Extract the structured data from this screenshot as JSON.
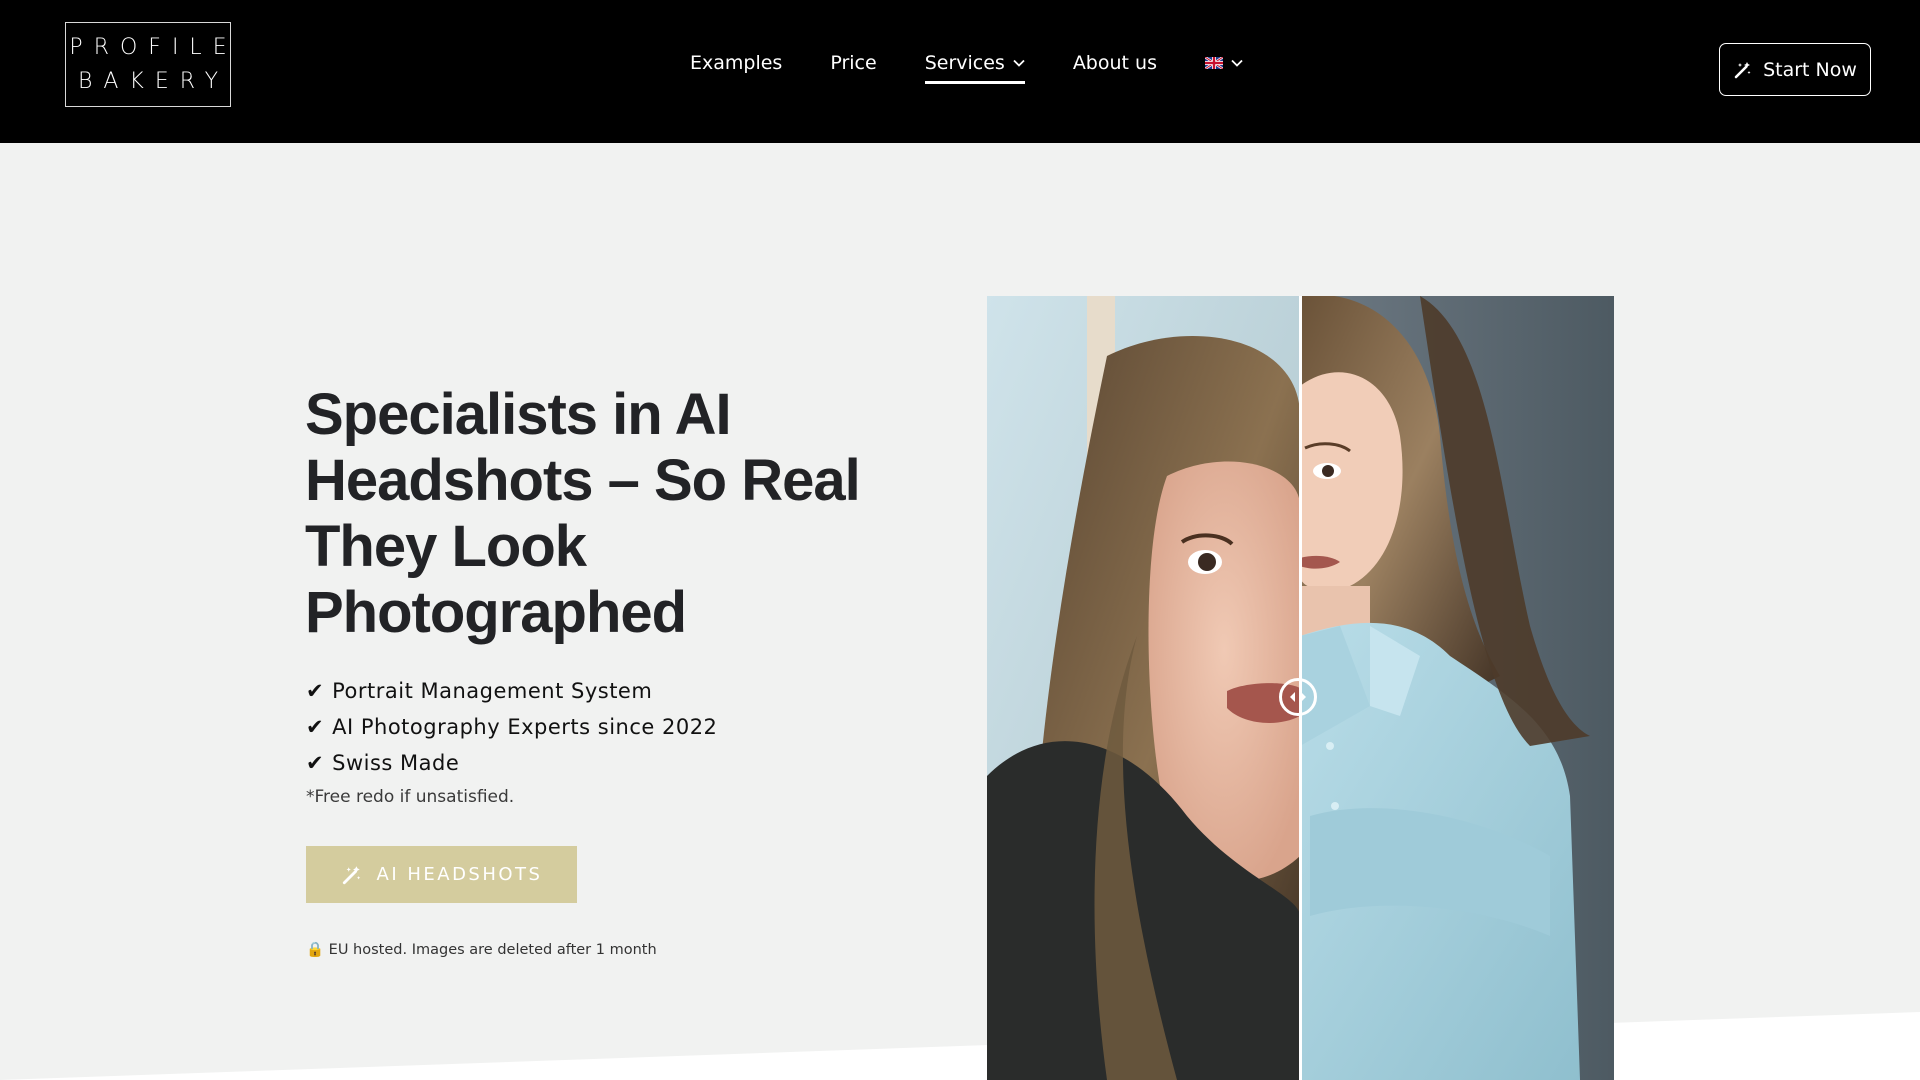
{
  "brand": {
    "line1": "PROFILE",
    "line2": "BAKERY"
  },
  "nav": {
    "items": [
      {
        "label": "Examples"
      },
      {
        "label": "Price"
      },
      {
        "label": "Services"
      },
      {
        "label": "About us"
      }
    ],
    "language_icon": "uk-flag-icon",
    "start_button": "Start Now"
  },
  "hero": {
    "title": "Specialists in AI Headshots – So Real They Look Photographed",
    "features": [
      "Portrait Management System",
      "AI Photography Experts since 2022",
      "Swiss Made"
    ],
    "check_symbol": "✔",
    "note": "*Free redo if unsatisfied.",
    "cta": "AI HEADSHOTS",
    "privacy_icon": "🔒",
    "privacy": "EU hosted. Images are deleted after 1 month"
  },
  "colors": {
    "header_bg": "#000000",
    "page_bg": "#f1f2f1",
    "cta_bg": "#d4cc9e",
    "title": "#222326"
  }
}
